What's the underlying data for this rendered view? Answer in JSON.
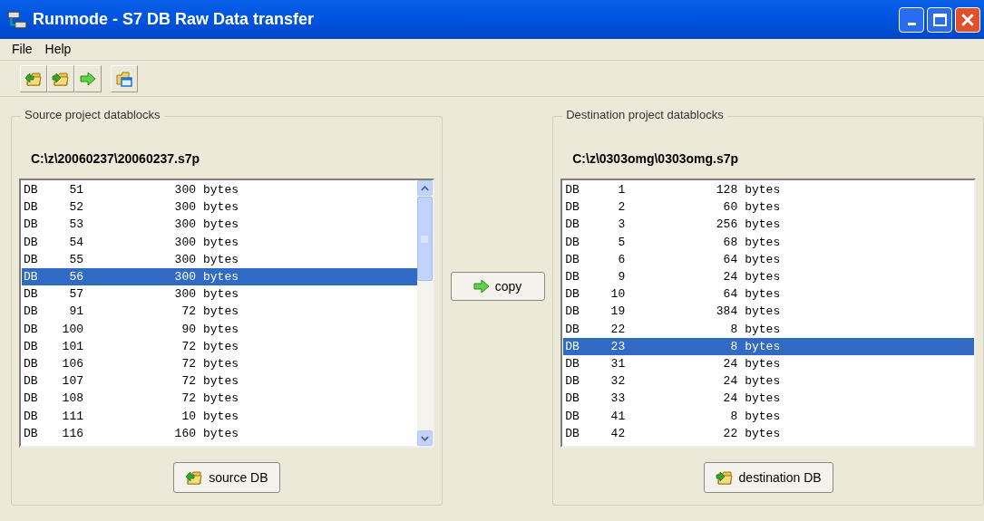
{
  "window": {
    "title": "Runmode - S7 DB Raw Data transfer"
  },
  "menu": [
    "File",
    "Help"
  ],
  "toolbar": [
    {
      "kind": "open-left"
    },
    {
      "kind": "open-right"
    },
    {
      "kind": "arrow"
    },
    {
      "kind": "window"
    }
  ],
  "source": {
    "title": "Source project datablocks",
    "path": "C:\\z\\20060237\\20060237.s7p",
    "button": "source DB",
    "rows": [
      {
        "type": "DB",
        "number": "51",
        "size": "300",
        "unit": "bytes",
        "selected": false
      },
      {
        "type": "DB",
        "number": "52",
        "size": "300",
        "unit": "bytes",
        "selected": false
      },
      {
        "type": "DB",
        "number": "53",
        "size": "300",
        "unit": "bytes",
        "selected": false
      },
      {
        "type": "DB",
        "number": "54",
        "size": "300",
        "unit": "bytes",
        "selected": false
      },
      {
        "type": "DB",
        "number": "55",
        "size": "300",
        "unit": "bytes",
        "selected": false
      },
      {
        "type": "DB",
        "number": "56",
        "size": "300",
        "unit": "bytes",
        "selected": true
      },
      {
        "type": "DB",
        "number": "57",
        "size": "300",
        "unit": "bytes",
        "selected": false
      },
      {
        "type": "DB",
        "number": "91",
        "size": "72",
        "unit": "bytes",
        "selected": false
      },
      {
        "type": "DB",
        "number": "100",
        "size": "90",
        "unit": "bytes",
        "selected": false
      },
      {
        "type": "DB",
        "number": "101",
        "size": "72",
        "unit": "bytes",
        "selected": false
      },
      {
        "type": "DB",
        "number": "106",
        "size": "72",
        "unit": "bytes",
        "selected": false
      },
      {
        "type": "DB",
        "number": "107",
        "size": "72",
        "unit": "bytes",
        "selected": false
      },
      {
        "type": "DB",
        "number": "108",
        "size": "72",
        "unit": "bytes",
        "selected": false
      },
      {
        "type": "DB",
        "number": "111",
        "size": "10",
        "unit": "bytes",
        "selected": false
      },
      {
        "type": "DB",
        "number": "116",
        "size": "160",
        "unit": "bytes",
        "selected": false
      }
    ]
  },
  "copy_button": "copy",
  "destination": {
    "title": "Destination project datablocks",
    "path": "C:\\z\\0303omg\\0303omg.s7p",
    "button": "destination DB",
    "rows": [
      {
        "type": "DB",
        "number": "1",
        "size": "128",
        "unit": "bytes",
        "selected": false
      },
      {
        "type": "DB",
        "number": "2",
        "size": "60",
        "unit": "bytes",
        "selected": false
      },
      {
        "type": "DB",
        "number": "3",
        "size": "256",
        "unit": "bytes",
        "selected": false
      },
      {
        "type": "DB",
        "number": "5",
        "size": "68",
        "unit": "bytes",
        "selected": false
      },
      {
        "type": "DB",
        "number": "6",
        "size": "64",
        "unit": "bytes",
        "selected": false
      },
      {
        "type": "DB",
        "number": "9",
        "size": "24",
        "unit": "bytes",
        "selected": false
      },
      {
        "type": "DB",
        "number": "10",
        "size": "64",
        "unit": "bytes",
        "selected": false
      },
      {
        "type": "DB",
        "number": "19",
        "size": "384",
        "unit": "bytes",
        "selected": false
      },
      {
        "type": "DB",
        "number": "22",
        "size": "8",
        "unit": "bytes",
        "selected": false
      },
      {
        "type": "DB",
        "number": "23",
        "size": "8",
        "unit": "bytes",
        "selected": true
      },
      {
        "type": "DB",
        "number": "31",
        "size": "24",
        "unit": "bytes",
        "selected": false
      },
      {
        "type": "DB",
        "number": "32",
        "size": "24",
        "unit": "bytes",
        "selected": false
      },
      {
        "type": "DB",
        "number": "33",
        "size": "24",
        "unit": "bytes",
        "selected": false
      },
      {
        "type": "DB",
        "number": "41",
        "size": "8",
        "unit": "bytes",
        "selected": false
      },
      {
        "type": "DB",
        "number": "42",
        "size": "22",
        "unit": "bytes",
        "selected": false
      }
    ]
  }
}
